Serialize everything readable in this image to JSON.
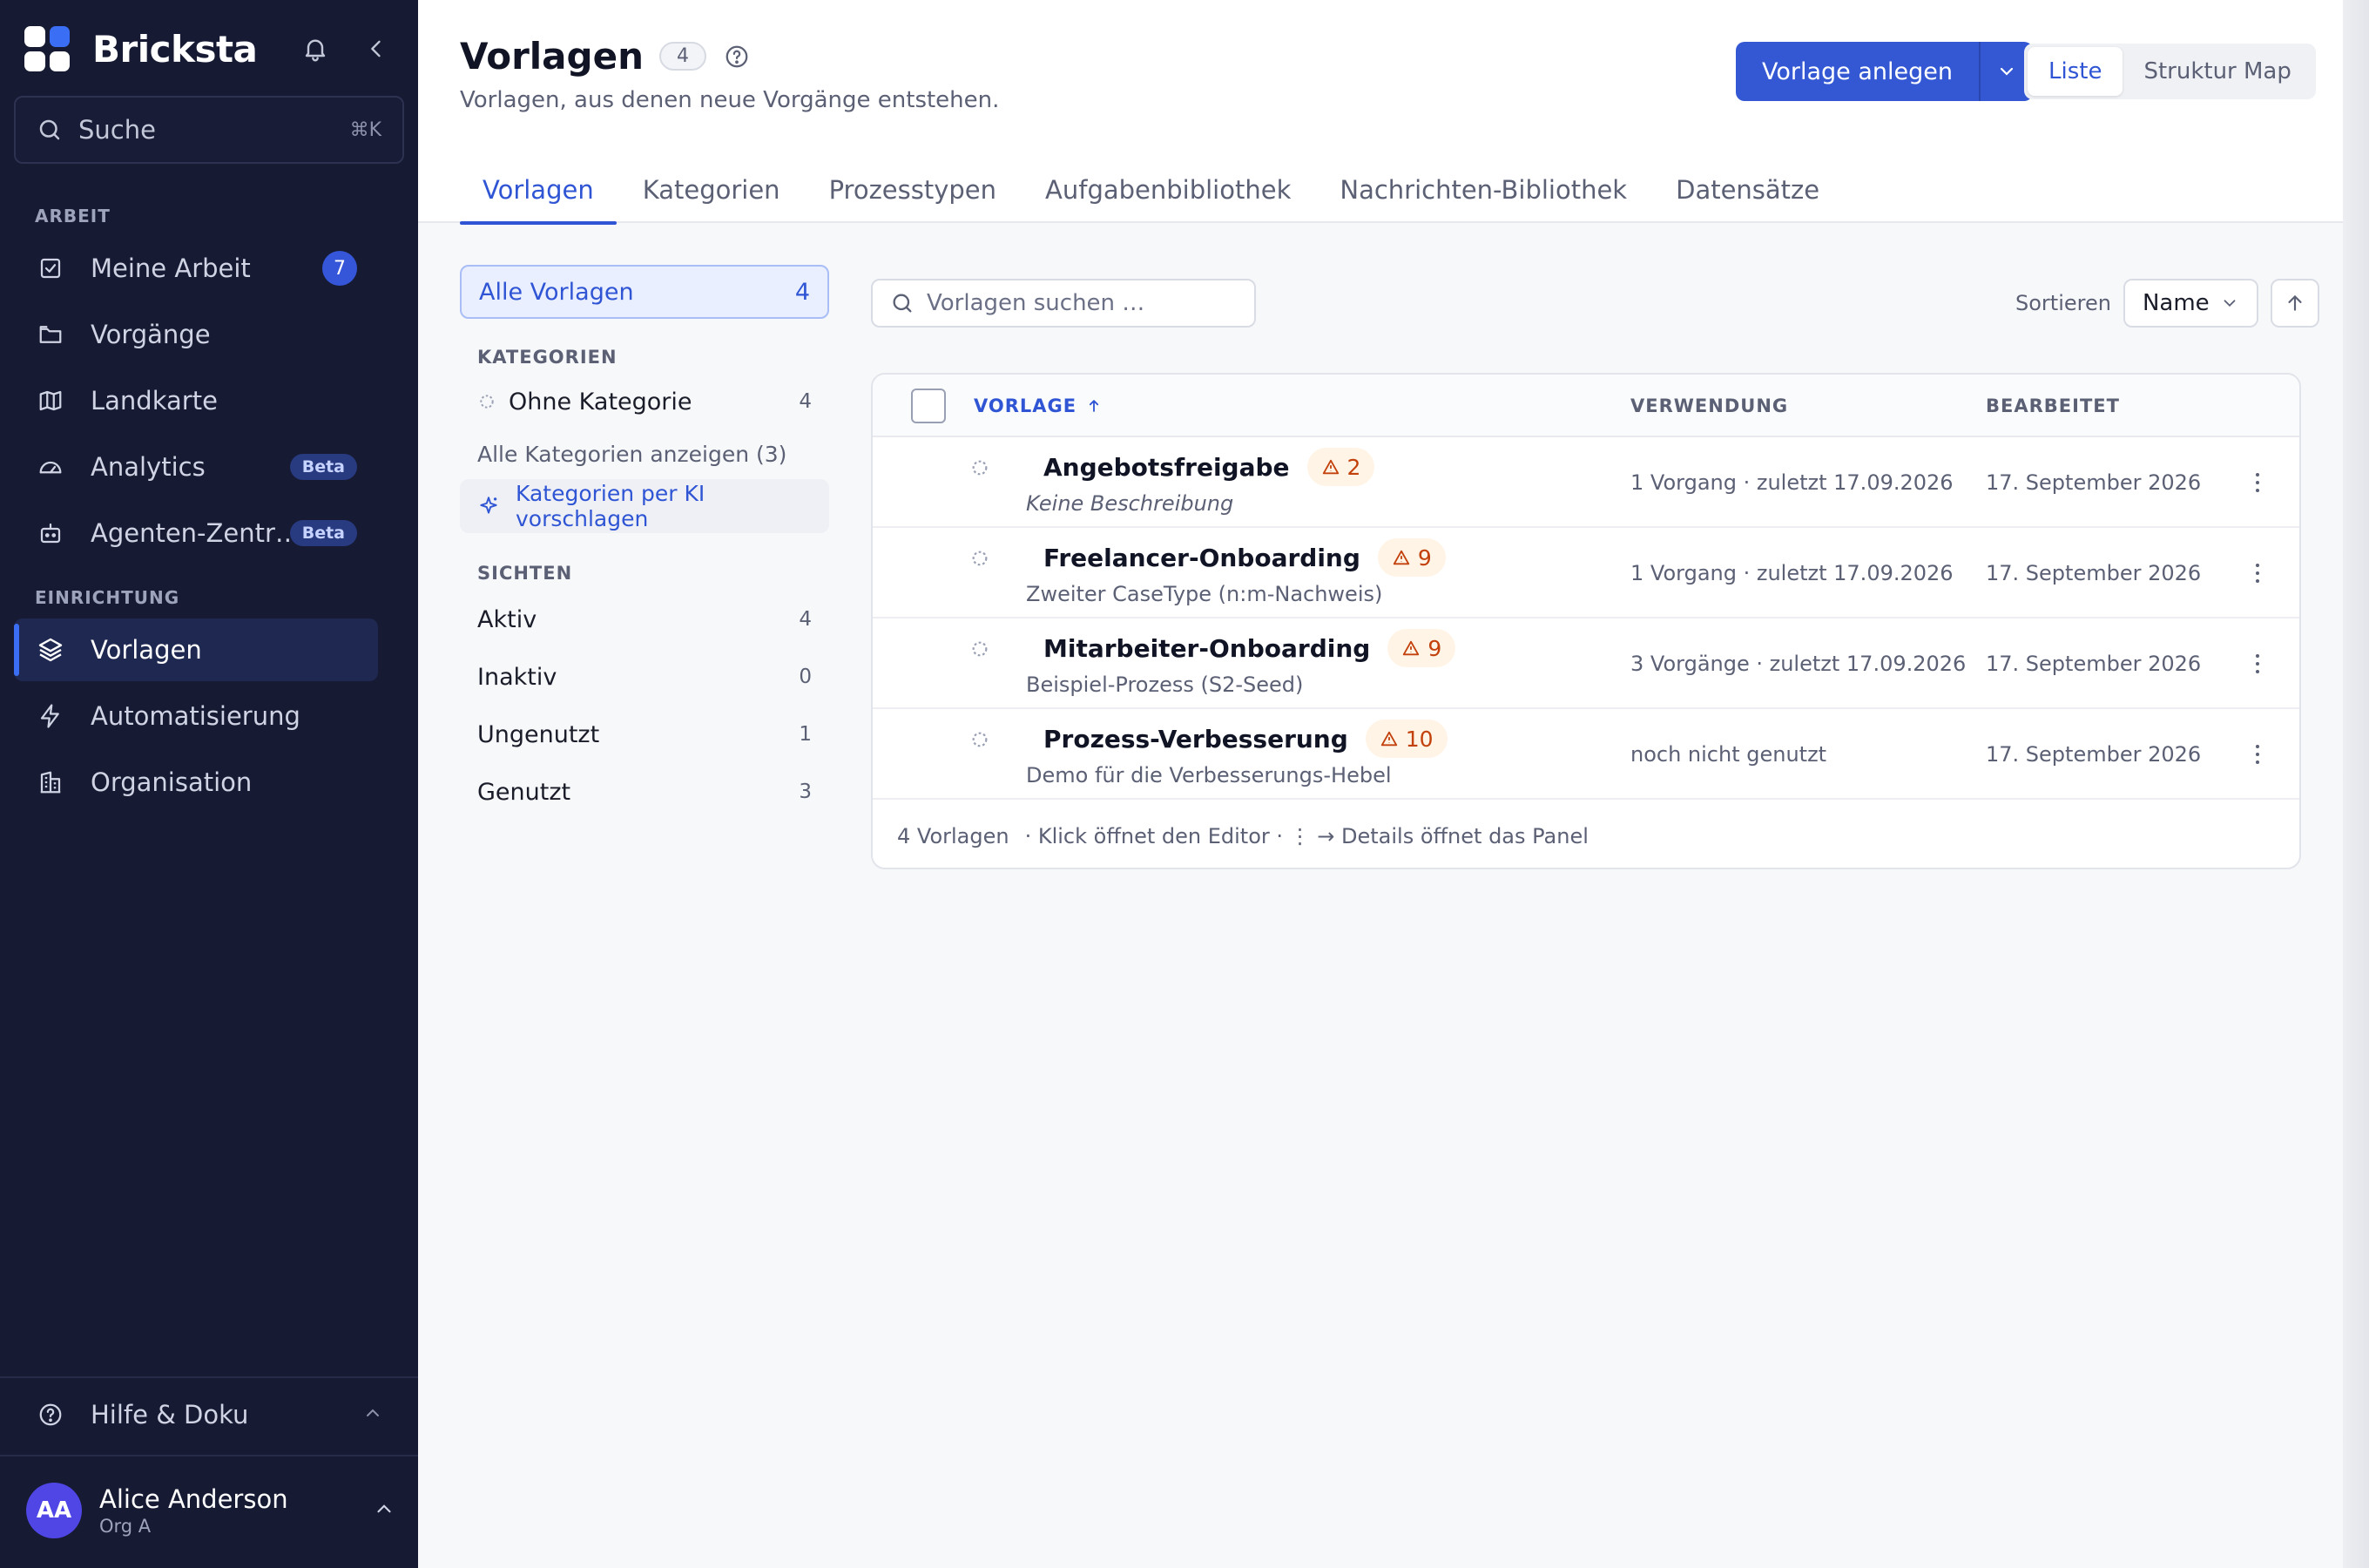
{
  "app": {
    "name": "Bricksta",
    "colors": {
      "sidebar_bg": "#161a33",
      "accent": "#3458d4",
      "warning": "#c2410c"
    }
  },
  "sidebar": {
    "search_placeholder": "Suche",
    "search_shortcut": "⌘K",
    "section_work": "ARBEIT",
    "section_setup": "EINRICHTUNG",
    "items": [
      {
        "label": "Meine Arbeit",
        "icon": "checkbox-icon",
        "badge": "7"
      },
      {
        "label": "Vorgänge",
        "icon": "folder-icon"
      },
      {
        "label": "Landkarte",
        "icon": "map-icon"
      },
      {
        "label": "Analytics",
        "icon": "gauge-icon",
        "badge": "Beta"
      },
      {
        "label": "Agenten-Zentr…",
        "icon": "robot-icon",
        "badge": "Beta"
      },
      {
        "label": "Vorlagen",
        "icon": "layers-icon",
        "active": true
      },
      {
        "label": "Automatisierung",
        "icon": "bolt-icon"
      },
      {
        "label": "Organisation",
        "icon": "building-icon"
      }
    ],
    "help_label": "Hilfe & Doku",
    "user": {
      "initials": "AA",
      "name": "Alice Anderson",
      "org": "Org A"
    }
  },
  "header": {
    "title": "Vorlagen",
    "count": "4",
    "subtitle": "Vorlagen, aus denen neue Vorgänge entstehen.",
    "primary_button": "Vorlage anlegen",
    "view_options": [
      "Liste",
      "Struktur Map"
    ],
    "active_view": "Liste",
    "tabs": [
      "Vorlagen",
      "Kategorien",
      "Prozesstypen",
      "Aufgabenbibliothek",
      "Nachrichten-Bibliothek",
      "Datensätze"
    ],
    "active_tab": "Vorlagen"
  },
  "filters": {
    "all_label": "Alle Vorlagen",
    "all_count": "4",
    "categories_heading": "KATEGORIEN",
    "categories": [
      {
        "label": "Ohne Kategorie",
        "count": "4"
      }
    ],
    "show_all_categories": "Alle Kategorien anzeigen (3)",
    "ai_suggest": "Kategorien per KI vorschlagen",
    "views_heading": "SICHTEN",
    "views": [
      {
        "label": "Aktiv",
        "count": "4"
      },
      {
        "label": "Inaktiv",
        "count": "0"
      },
      {
        "label": "Ungenutzt",
        "count": "1"
      },
      {
        "label": "Genutzt",
        "count": "3"
      }
    ]
  },
  "toolbar": {
    "search_placeholder": "Vorlagen suchen …",
    "sort_label": "Sortieren",
    "sort_value": "Name"
  },
  "table": {
    "columns": [
      "VORLAGE",
      "VERWENDUNG",
      "BEARBEITET"
    ],
    "rows": [
      {
        "name": "Angebotsfreigabe",
        "warnings": "2",
        "description": "Keine Beschreibung",
        "description_italic": true,
        "usage": "1 Vorgang · zuletzt 17.09.2026",
        "edited": "17. September 2026"
      },
      {
        "name": "Freelancer-Onboarding",
        "warnings": "9",
        "description": "Zweiter CaseType (n:m-Nachweis)",
        "usage": "1 Vorgang · zuletzt 17.09.2026",
        "edited": "17. September 2026"
      },
      {
        "name": "Mitarbeiter-Onboarding",
        "warnings": "9",
        "description": "Beispiel-Prozess (S2-Seed)",
        "usage": "3 Vorgänge · zuletzt 17.09.2026",
        "edited": "17. September 2026"
      },
      {
        "name": "Prozess-Verbesserung",
        "warnings": "10",
        "description": "Demo für die Verbesserungs-Hebel",
        "usage": "noch nicht genutzt",
        "edited": "17. September 2026"
      }
    ],
    "footer_count": "4 Vorlagen",
    "footer_hint": "· Klick öffnet den Editor · ⋮ → Details öffnet das Panel"
  }
}
